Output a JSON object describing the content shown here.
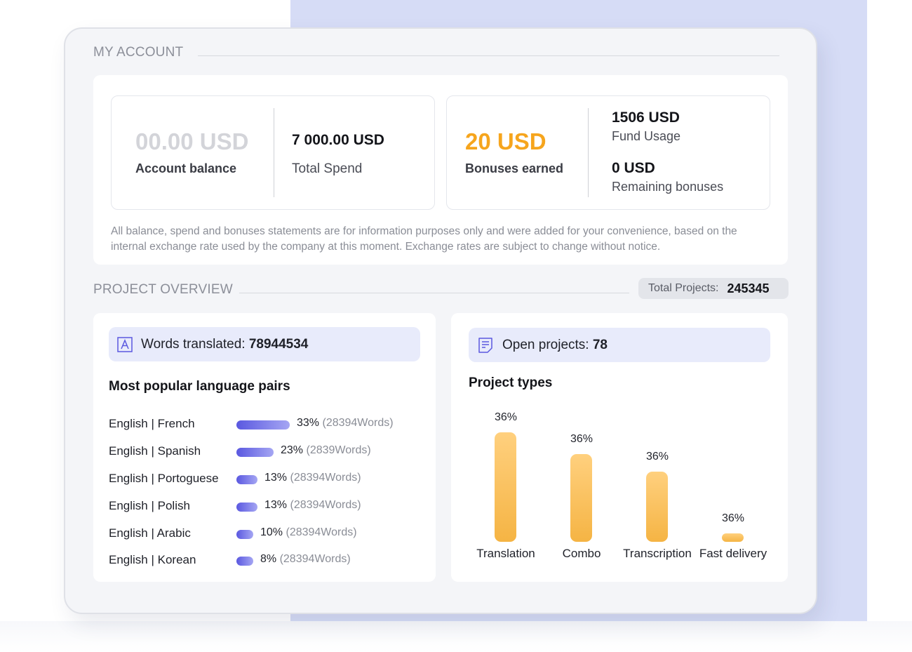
{
  "account": {
    "section_title": "MY ACCOUNT",
    "balance_value": "00.00 USD",
    "balance_label": "Account balance",
    "spend_value": "7 000.00 USD",
    "spend_label": "Total Spend",
    "bonus_value": "20 USD",
    "bonus_label": "Bonuses earned",
    "fund_value": "1506 USD",
    "fund_label": "Fund Usage",
    "remaining_value": "0 USD",
    "remaining_label": "Remaining bonuses",
    "note": "All balance, spend and bonuses statements are for information purposes only and were added for your convenience, based on the internal exchange rate used by the company at this moment. Exchange rates are subject to change without notice."
  },
  "overview": {
    "section_title": "PROJECT OVERVIEW",
    "total_label": "Total Projects:",
    "total_value": "245345",
    "words_label": "Words translated:",
    "words_value": "78944534",
    "open_label": "Open projects:",
    "open_value": "78",
    "pairs_title": "Most popular language pairs",
    "types_title": "Project types"
  },
  "language_pairs": [
    {
      "name": "English | French",
      "pct": "33%",
      "words": "(28394Words)",
      "value": 33
    },
    {
      "name": "English | Spanish",
      "pct": "23%",
      "words": "(2839Words)",
      "value": 23
    },
    {
      "name": "English | Portoguese",
      "pct": "13%",
      "words": "(28394Words)",
      "value": 13
    },
    {
      "name": "English | Polish",
      "pct": "13%",
      "words": "(28394Words)",
      "value": 13
    },
    {
      "name": "English | Arabic",
      "pct": "10%",
      "words": "(28394Words)",
      "value": 10
    },
    {
      "name": "English | Korean",
      "pct": "8%",
      "words": "(28394Words)",
      "value": 8
    }
  ],
  "project_types": [
    {
      "label": "Translation",
      "pct": "36%",
      "level": 1.0
    },
    {
      "label": "Combo",
      "pct": "36%",
      "level": 0.8
    },
    {
      "label": "Transcription",
      "pct": "36%",
      "level": 0.64
    },
    {
      "label": "Fast delivery",
      "pct": "36%",
      "level": 0.08
    }
  ],
  "colors": {
    "accent_bg": "#d6dcf6",
    "orange": "#f6a51d",
    "bar_purple": "#5a58e0",
    "bar_orange": "#f5b444",
    "stat_bg": "#e8ebfb"
  },
  "icons": {
    "words": "translate-letter-icon",
    "open": "document-lines-icon"
  }
}
